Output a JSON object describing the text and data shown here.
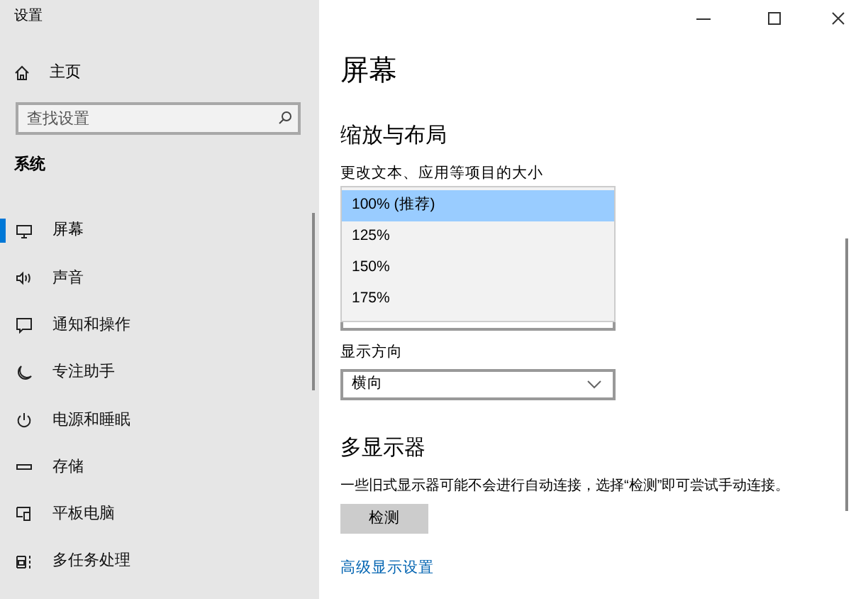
{
  "window": {
    "title": "设置"
  },
  "sidebar": {
    "home": "主页",
    "search": {
      "placeholder": "查找设置"
    },
    "section": "系统",
    "items": [
      {
        "label": "屏幕",
        "selected": true
      },
      {
        "label": "声音",
        "selected": false
      },
      {
        "label": "通知和操作",
        "selected": false
      },
      {
        "label": "专注助手",
        "selected": false
      },
      {
        "label": "电源和睡眠",
        "selected": false
      },
      {
        "label": "存储",
        "selected": false
      },
      {
        "label": "平板电脑",
        "selected": false
      },
      {
        "label": "多任务处理",
        "selected": false
      }
    ]
  },
  "main": {
    "title": "屏幕",
    "scale_section": {
      "heading": "缩放与布局",
      "scale_label": "更改文本、应用等项目的大小",
      "scale_options": [
        {
          "label": "100% (推荐)",
          "selected": true
        },
        {
          "label": "125%",
          "selected": false
        },
        {
          "label": "150%",
          "selected": false
        },
        {
          "label": "175%",
          "selected": false
        }
      ],
      "orientation_label": "显示方向",
      "orientation_value": "横向"
    },
    "multi_section": {
      "heading": "多显示器",
      "description": "一些旧式显示器可能不会进行自动连接，选择“检测”即可尝试手动连接。",
      "button": "检测",
      "link": "高级显示设置"
    }
  }
}
